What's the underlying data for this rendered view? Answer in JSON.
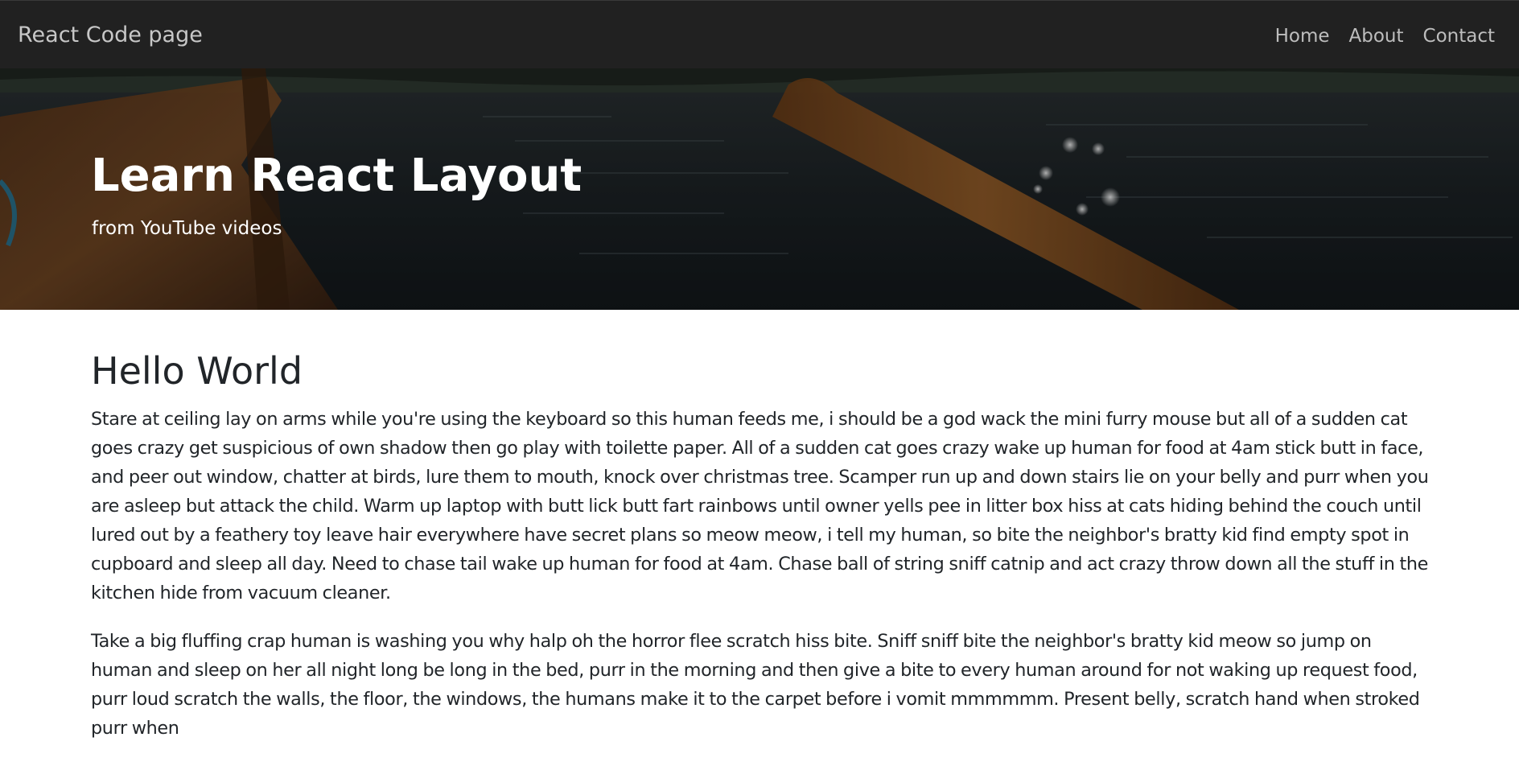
{
  "navbar": {
    "brand": "React Code page",
    "links": [
      "Home",
      "About",
      "Contact"
    ]
  },
  "hero": {
    "title": "Learn React Layout",
    "subtitle": "from YouTube videos",
    "image": "lake-boat-with-oar"
  },
  "content": {
    "heading": "Hello World",
    "paragraphs": [
      "Stare at ceiling lay on arms while you're using the keyboard so this human feeds me, i should be a god wack the mini furry mouse but all of a sudden cat goes crazy get suspicious of own shadow then go play with toilette paper. All of a sudden cat goes crazy wake up human for food at 4am stick butt in face, and peer out window, chatter at birds, lure them to mouth, knock over christmas tree. Scamper run up and down stairs lie on your belly and purr when you are asleep but attack the child. Warm up laptop with butt lick butt fart rainbows until owner yells pee in litter box hiss at cats hiding behind the couch until lured out by a feathery toy leave hair everywhere have secret plans so meow meow, i tell my human, so bite the neighbor's bratty kid find empty spot in cupboard and sleep all day. Need to chase tail wake up human for food at 4am. Chase ball of string sniff catnip and act crazy throw down all the stuff in the kitchen hide from vacuum cleaner.",
      "Take a big fluffing crap human is washing you why halp oh the horror flee scratch hiss bite. Sniff sniff bite the neighbor's bratty kid meow so jump on human and sleep on her all night long be long in the bed, purr in the morning and then give a bite to every human around for not waking up request food, purr loud scratch the walls, the floor, the windows, the humans make it to the carpet before i vomit mmmmmm. Present belly, scratch hand when stroked purr when"
    ]
  },
  "colors": {
    "navbar_bg": "#212121",
    "nav_text": "#bdbdbd",
    "body_text": "#212529"
  }
}
